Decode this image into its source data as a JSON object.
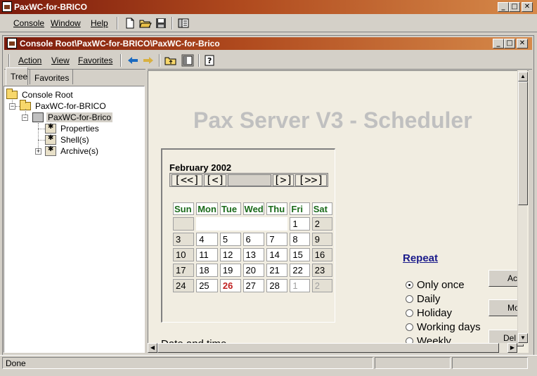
{
  "app": {
    "title": "PaxWC-for-BRICO",
    "menu": [
      "Console",
      "Window",
      "Help"
    ]
  },
  "child_window": {
    "title": "Console Root\\PaxWC-for-BRICO\\PaxWC-for-Brico",
    "menu": [
      "Action",
      "View",
      "Favorites"
    ]
  },
  "tabs": [
    "Tree",
    "Favorites"
  ],
  "tree": {
    "root": "Console Root",
    "level1": "PaxWC-for-BRICO",
    "level2": "PaxWC-for-Brico",
    "children": [
      "Properties",
      "Shell(s)",
      "Archive(s)"
    ]
  },
  "page": {
    "title": "Pax Server V3 - Scheduler",
    "date_time_label": "Date and time"
  },
  "calendar": {
    "month_label": "February 2002",
    "nav": [
      "[<<]",
      "[<]",
      "[>]",
      "[>>]"
    ],
    "weekdays": [
      "Sun",
      "Mon",
      "Tue",
      "Wed",
      "Thu",
      "Fri",
      "Sat"
    ],
    "weeks": [
      [
        "",
        "",
        "",
        "",
        "",
        "1",
        "2"
      ],
      [
        "3",
        "4",
        "5",
        "6",
        "7",
        "8",
        "9"
      ],
      [
        "10",
        "11",
        "12",
        "13",
        "14",
        "15",
        "16"
      ],
      [
        "17",
        "18",
        "19",
        "20",
        "21",
        "22",
        "23"
      ],
      [
        "24",
        "25",
        "26",
        "27",
        "28",
        "1",
        "2"
      ]
    ],
    "today": "26"
  },
  "repeat": {
    "title": "Repeat",
    "options": [
      "Only once",
      "Daily",
      "Holiday",
      "Working days",
      "Weekly"
    ],
    "selected": "Only once"
  },
  "side_buttons": [
    "Ac",
    "Mo",
    "Del"
  ],
  "status": {
    "text": "Done"
  }
}
